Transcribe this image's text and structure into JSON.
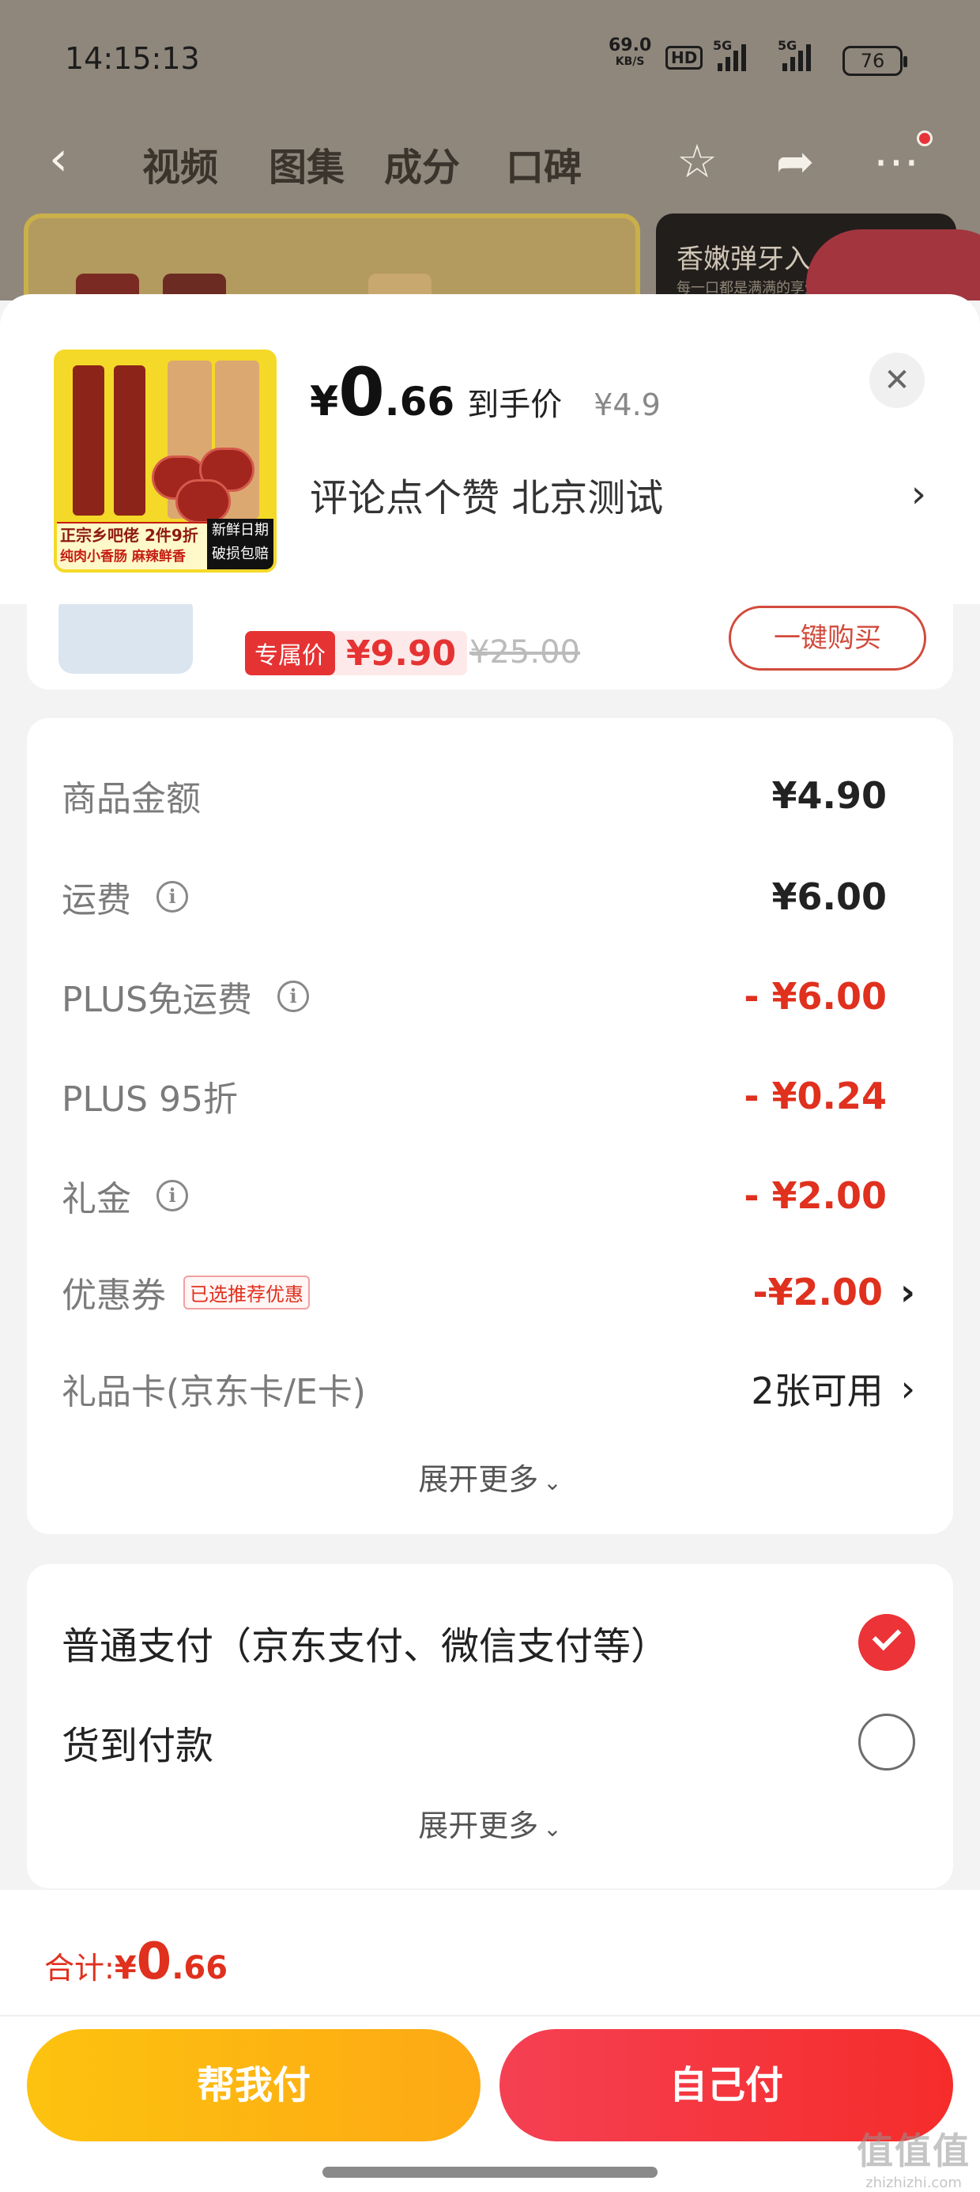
{
  "status_bar": {
    "time": "14:15:13",
    "net_speed": "69.0",
    "net_unit": "KB/S",
    "hd": "HD",
    "sig1": "5G",
    "sig2": "5G",
    "battery": "76"
  },
  "nav": {
    "tabs": [
      "视频",
      "图集",
      "成分",
      "口碑"
    ]
  },
  "background": {
    "dark_card_title": "香嫩弹牙入",
    "dark_card_sub": "每一口都是满满的享受"
  },
  "product": {
    "thumb_tag_left": "正宗乡吧佬 2件9折",
    "thumb_tag_left_sub": "纯肉小香肠 麻辣鲜香",
    "thumb_tag_right": "新鲜日期破损包赔",
    "price_yen": "¥",
    "price_int": "0",
    "price_dec": ".66",
    "price_label": "到手价",
    "orig_price": "¥4.9",
    "comment_line": "评论点个赞 北京测试"
  },
  "partial_card": {
    "badge": "专属价",
    "price": "¥9.90",
    "orig": "¥25.00",
    "buy_label": "一键购买"
  },
  "fees": {
    "items": [
      {
        "label": "商品金额",
        "value": "¥4.90"
      },
      {
        "label": "运费",
        "value": "¥6.00"
      },
      {
        "label": "PLUS免运费",
        "value": "- ¥6.00"
      },
      {
        "label": "PLUS 95折",
        "value": "- ¥0.24"
      },
      {
        "label": "礼金",
        "value": "- ¥2.00"
      },
      {
        "label": "优惠券",
        "tag": "已选推荐优惠",
        "value": "-¥2.00"
      },
      {
        "label": "礼品卡(京东卡/E卡)",
        "value": "2张可用"
      }
    ],
    "expand_label": "展开更多"
  },
  "payment": {
    "options": [
      {
        "label": "普通支付（京东支付、微信支付等）",
        "selected": true
      },
      {
        "label": "货到付款",
        "selected": false
      }
    ],
    "expand_label": "展开更多"
  },
  "footer": {
    "total_label": "合计:",
    "total_yen": "¥",
    "total_int": "0",
    "total_dec": ".66",
    "help_pay": "帮我付",
    "self_pay": "自己付",
    "watermark": "值值值",
    "watermark_sub": "zhizhizhi.com"
  },
  "colors": {
    "accent_red": "#e0301e",
    "help_pay_yellow": "#fdb912",
    "self_pay_red": "#f5363d"
  },
  "icons": {
    "back": "chevron-left-icon",
    "favorite": "star-icon",
    "share": "share-icon",
    "more": "more-icon",
    "close": "close-icon",
    "info": "info-icon",
    "chevron": "chevron-right-icon",
    "check": "check-icon"
  }
}
